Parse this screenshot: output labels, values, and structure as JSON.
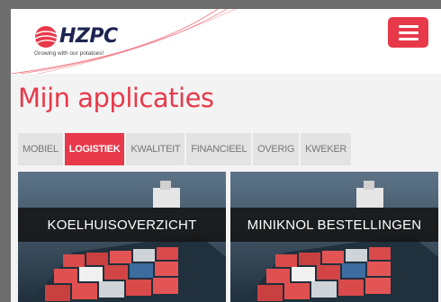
{
  "brand": {
    "name": "HZPC",
    "tagline": "Growing with our potatoes!"
  },
  "header": {
    "menu_icon": "hamburger-menu-icon"
  },
  "page_title": "Mijn applicaties",
  "tabs": [
    {
      "label": "MOBIEL",
      "active": false
    },
    {
      "label": "LOGISTIEK",
      "active": true
    },
    {
      "label": "KWALITEIT",
      "active": false
    },
    {
      "label": "FINANCIEEL",
      "active": false
    },
    {
      "label": "OVERIG",
      "active": false
    },
    {
      "label": "KWEKER",
      "active": false
    }
  ],
  "tiles": [
    {
      "label": "KOELHUISOVERZICHT",
      "image": "container-ship-image"
    },
    {
      "label": "MINIKNOL BESTELLINGEN",
      "image": "container-ship-image"
    }
  ],
  "colors": {
    "accent": "#e8394a",
    "brand_navy": "#1d2450",
    "tab_bg": "#e3e3e3",
    "page_bg": "#f3f3f3"
  }
}
